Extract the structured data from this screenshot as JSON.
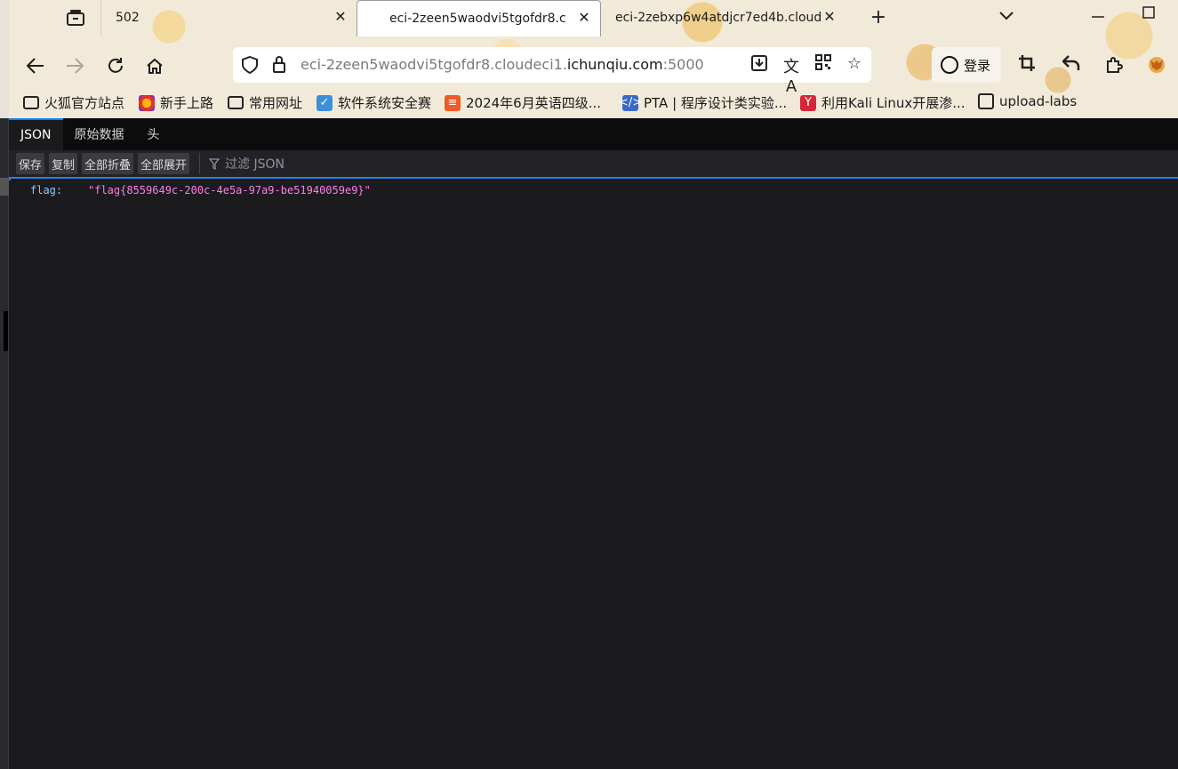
{
  "browser": {
    "tabs": [
      {
        "title": "502",
        "active": false
      },
      {
        "title": "eci-2zeen5waodvi5tgofdr8.c",
        "active": true
      },
      {
        "title": "eci-2zebxp6w4atdjcr7ed4b.cloud",
        "active": false
      }
    ],
    "url": {
      "prefix": "eci-2zeen5waodvi5tgofdr8.cloudeci1.",
      "domain": "ichunqiu.com",
      "port": ":5000"
    },
    "login_label": "登录",
    "bookmarks": [
      {
        "label": "火狐官方站点",
        "icon": "folder-icon"
      },
      {
        "label": "新手上路",
        "icon": "firefox-icon"
      },
      {
        "label": "常用网址",
        "icon": "folder-icon"
      },
      {
        "label": "软件系统安全赛",
        "icon": "shield-icon"
      },
      {
        "label": "2024年6月英语四级...",
        "icon": "document-icon"
      },
      {
        "label": "PTA | 程序设计类实验...",
        "icon": "pta-icon"
      },
      {
        "label": "利用Kali Linux开展渗...",
        "icon": "kali-icon"
      },
      {
        "label": "upload-labs",
        "icon": "globe-icon"
      }
    ],
    "accent": "#0a84ff"
  },
  "viewer": {
    "tabs": [
      {
        "label": "JSON",
        "active": true
      },
      {
        "label": "原始数据",
        "active": false
      },
      {
        "label": "头",
        "active": false
      }
    ],
    "toolbar": {
      "save": "保存",
      "copy": "复制",
      "collapse_all": "全部折叠",
      "expand_all": "全部展开",
      "filter_placeholder": "过滤 JSON"
    },
    "json": {
      "key": "flag:",
      "value": "\"flag{8559649c-200c-4e5a-97a9-be51940059e9}\""
    }
  }
}
